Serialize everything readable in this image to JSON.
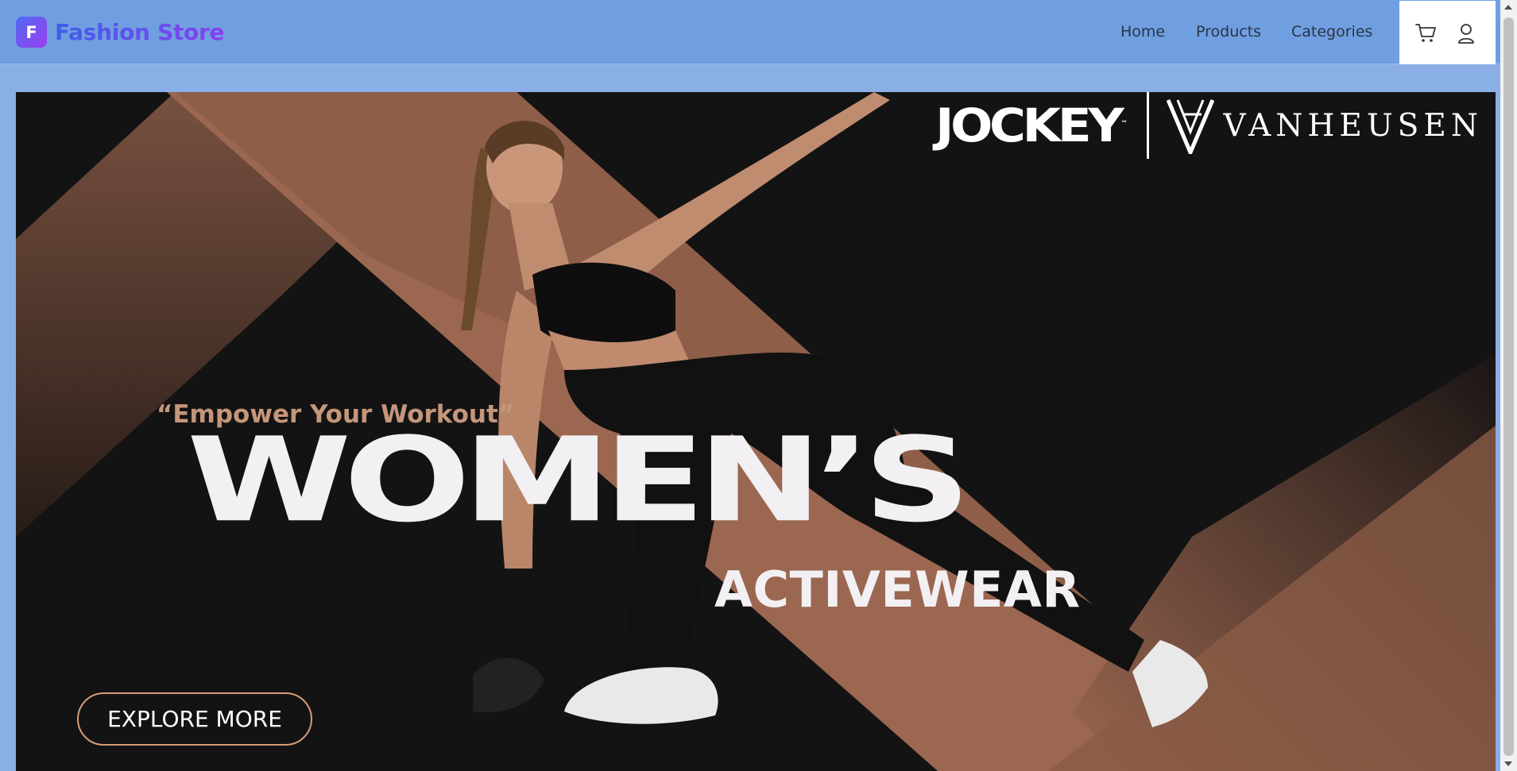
{
  "header": {
    "logo_letter": "F",
    "logo_text": "Fashion Store",
    "nav": [
      "Home",
      "Products",
      "Categories"
    ],
    "icons": [
      "cart-icon",
      "user-icon"
    ]
  },
  "banner": {
    "brand_1": "JOCKEY",
    "brand_1_mark": "™",
    "brand_2": "VANHEUSEN",
    "tagline": "“Empower Your Workout”",
    "headline": "WOMEN’S",
    "subhead": "ACTIVEWEAR",
    "cta": "EXPLORE MORE",
    "colors": {
      "background": "#141313",
      "accent": "#9b6750",
      "text": "#f3f0f3",
      "tagline": "#c5967a"
    }
  }
}
